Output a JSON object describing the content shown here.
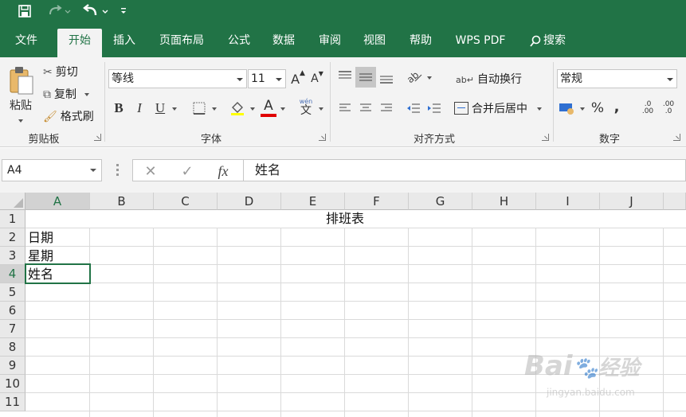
{
  "quick_access": {
    "save_icon": "save-icon",
    "redo_icon": "redo-icon",
    "undo_icon": "undo-icon",
    "customize_icon": "customize-icon"
  },
  "tabs": [
    {
      "label": "文件"
    },
    {
      "label": "开始"
    },
    {
      "label": "插入"
    },
    {
      "label": "页面布局"
    },
    {
      "label": "公式"
    },
    {
      "label": "数据"
    },
    {
      "label": "审阅"
    },
    {
      "label": "视图"
    },
    {
      "label": "帮助"
    },
    {
      "label": "WPS PDF"
    },
    {
      "label": "搜索"
    }
  ],
  "ribbon": {
    "clipboard": {
      "paste": "粘贴",
      "cut": "剪切",
      "copy": "复制",
      "format_painter": "格式刷",
      "group": "剪贴板"
    },
    "font": {
      "name": "等线",
      "size": "11",
      "bold": "B",
      "italic": "I",
      "underline": "U",
      "font_color_letter": "A",
      "phonetic": "文",
      "phonetic_top": "wén",
      "group": "字体"
    },
    "alignment": {
      "wrap": "自动换行",
      "merge": "合并后居中",
      "group": "对齐方式"
    },
    "number": {
      "format": "常规",
      "percent": "%",
      "comma": ",",
      "inc_decimal": ".00",
      "dec_decimal": ".0",
      "group": "数字"
    }
  },
  "formula_bar": {
    "name_box": "A4",
    "cancel": "✕",
    "enter": "✓",
    "fx": "fx",
    "value": "姓名"
  },
  "sheet": {
    "columns": [
      "A",
      "B",
      "C",
      "D",
      "E",
      "F",
      "G",
      "H",
      "I",
      "J"
    ],
    "rows": [
      "1",
      "2",
      "3",
      "4",
      "5",
      "6",
      "7",
      "8",
      "9",
      "10",
      "11"
    ],
    "cells": {
      "D1": "排班表",
      "A2": "日期",
      "A3": "星期",
      "A4": "姓名"
    },
    "selected": "A4"
  },
  "watermark": {
    "brand": "Bai",
    "brand2": "经验",
    "url": "jingyan.baidu.com"
  },
  "colors": {
    "accent": "#217346"
  }
}
